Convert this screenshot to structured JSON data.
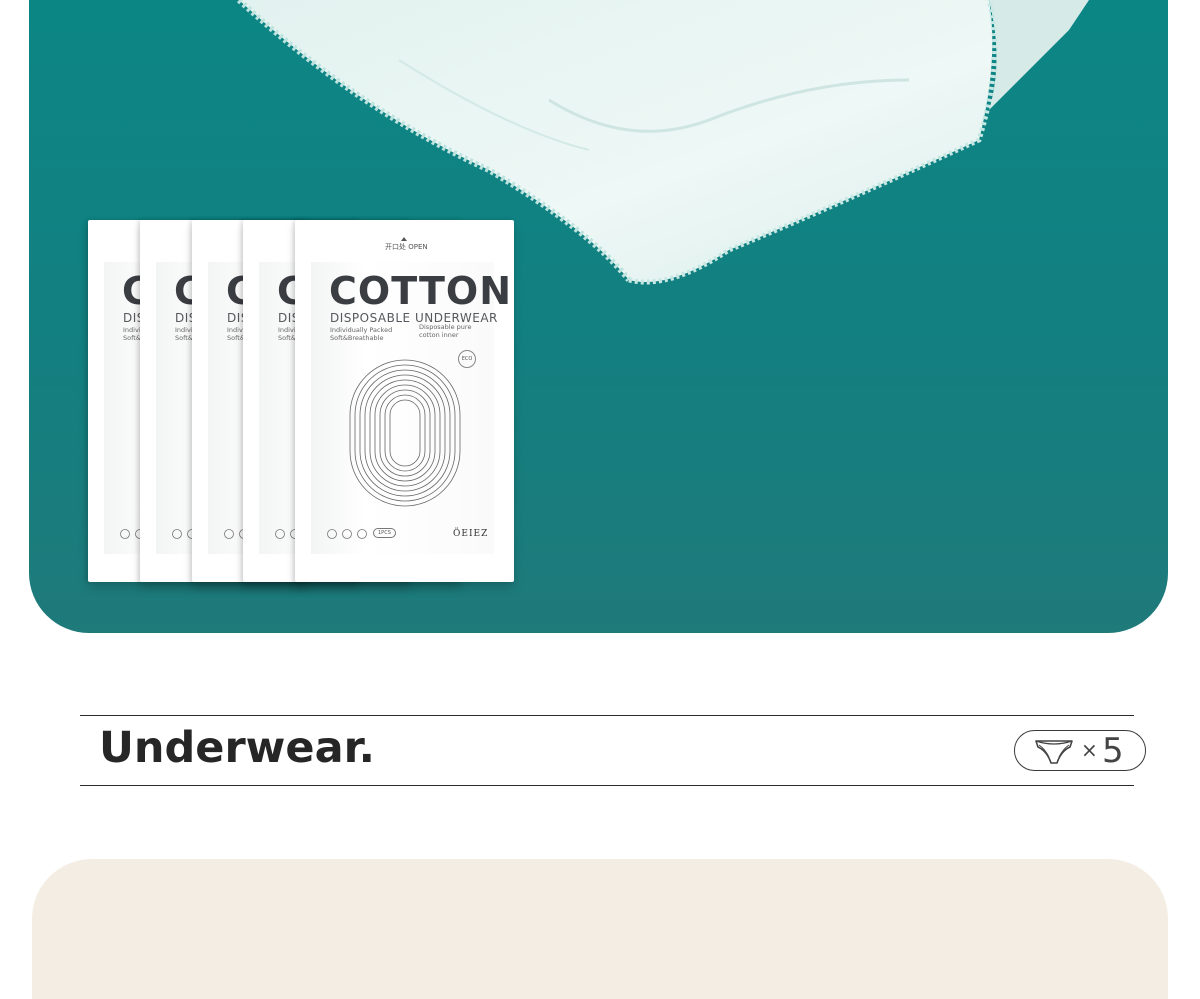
{
  "pack": {
    "headline": "COTTON",
    "subtitle": "DISPOSABLE UNDERWEAR",
    "line1": "Individually Packed",
    "line2": "Soft&Breathable",
    "note": "Disposable pure cotton inner",
    "open_label": "开口处 OPEN",
    "eco_label": "ECO",
    "count_badge": "1PCS",
    "brand": "ÖEIEZ",
    "count": 5
  },
  "section": {
    "title": "Underwear.",
    "times": "×",
    "quantity": "5"
  },
  "colors": {
    "hero_teal": "#0c8685",
    "beige": "#f4ede3",
    "text_dark": "#262626"
  },
  "icons": [
    "briefs-icon"
  ]
}
